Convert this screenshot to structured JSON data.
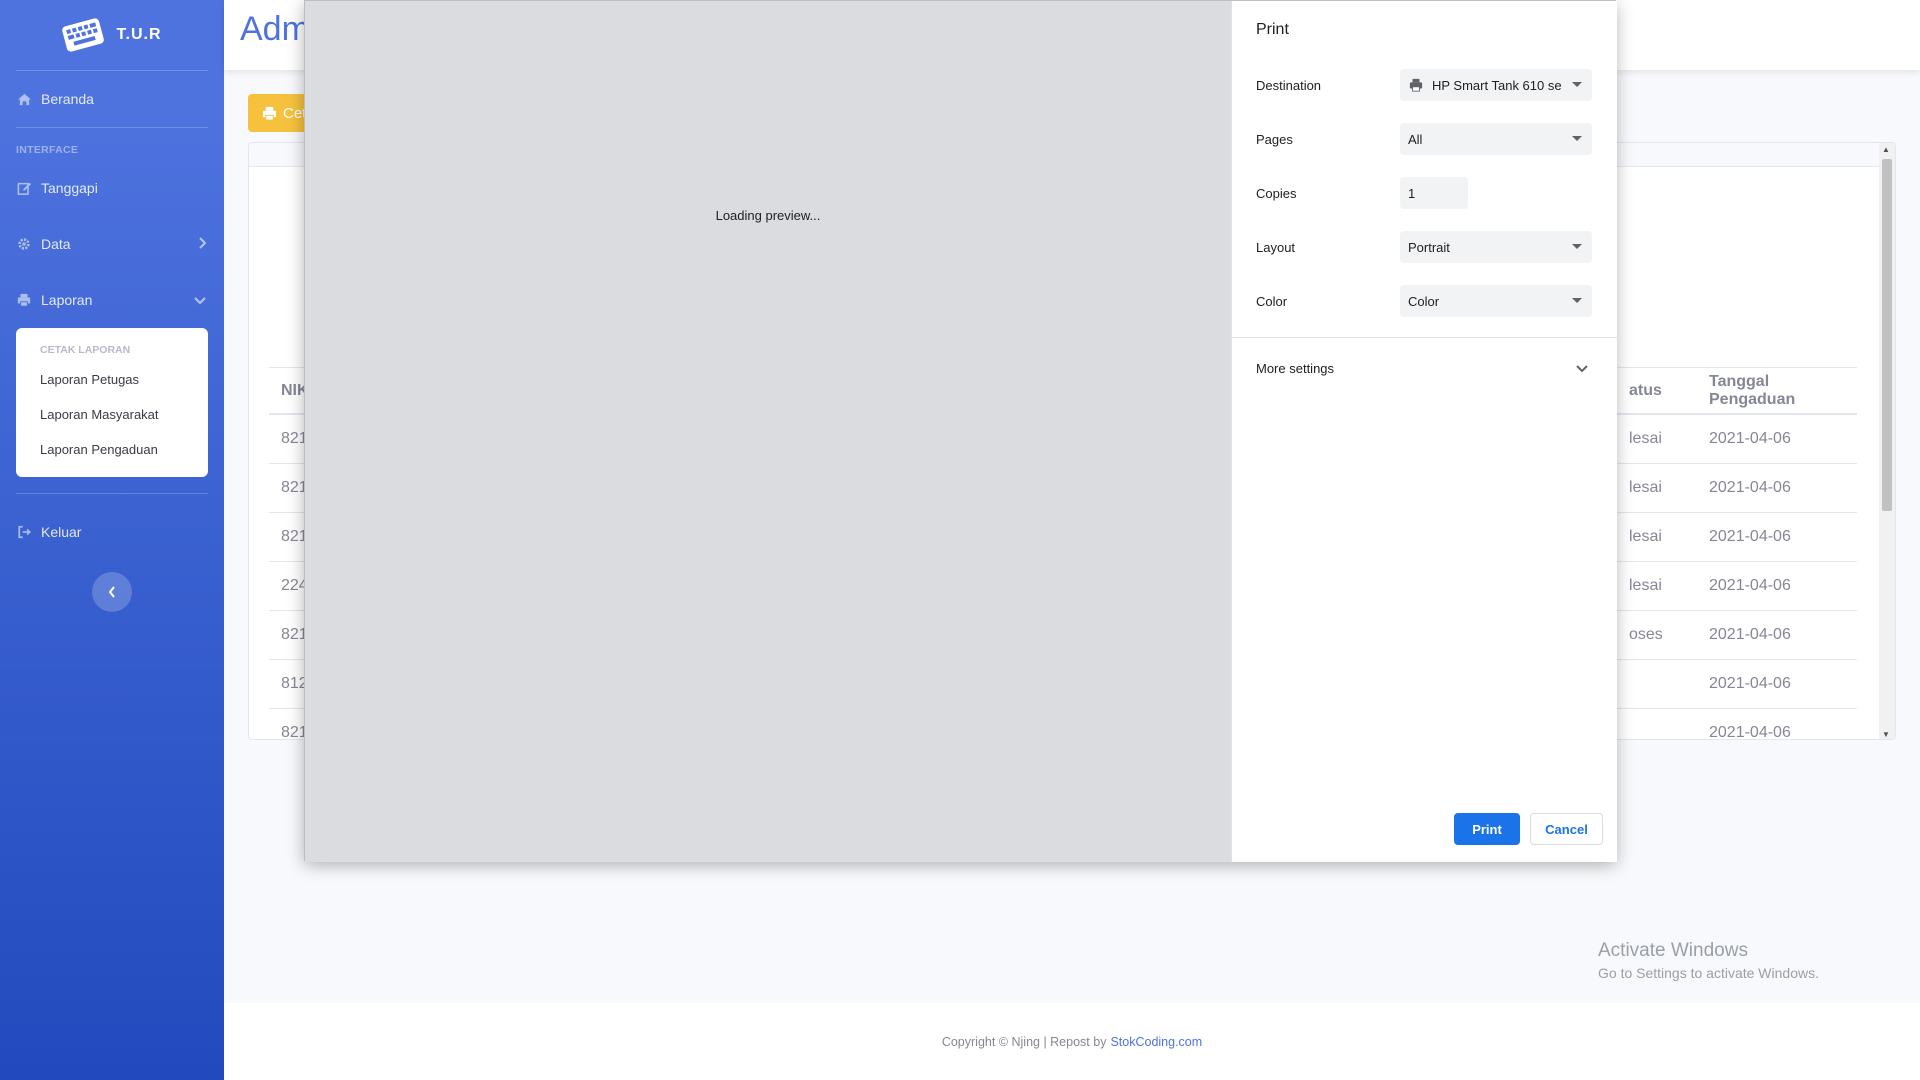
{
  "sidebar": {
    "brand": "T.U.R",
    "home_label": "Beranda",
    "heading_interface": "INTERFACE",
    "items": [
      {
        "label": "Tanggapi"
      },
      {
        "label": "Data"
      },
      {
        "label": "Laporan"
      }
    ],
    "submenu": {
      "header": "CETAK LAPORAN",
      "items": [
        "Laporan Petugas",
        "Laporan Masyarakat",
        "Laporan Pengaduan"
      ]
    },
    "logout_label": "Keluar"
  },
  "topbar": {
    "title": "Adm"
  },
  "content": {
    "print_button": "Cet",
    "table": {
      "headers": [
        "NIK",
        "atus",
        "Tanggal Pengaduan"
      ],
      "rows": [
        [
          "821",
          "lesai",
          "2021-04-06"
        ],
        [
          "821",
          "lesai",
          "2021-04-06"
        ],
        [
          "821",
          "lesai",
          "2021-04-06"
        ],
        [
          "224",
          "lesai",
          "2021-04-06"
        ],
        [
          "821",
          "oses",
          "2021-04-06"
        ],
        [
          "812",
          "",
          "2021-04-06"
        ],
        [
          "821",
          "",
          "2021-04-06"
        ]
      ]
    }
  },
  "print_dialog": {
    "preview_text": "Loading preview...",
    "title": "Print",
    "destination_label": "Destination",
    "destination_value": "HP Smart Tank 610 se",
    "pages_label": "Pages",
    "pages_value": "All",
    "copies_label": "Copies",
    "copies_value": "1",
    "layout_label": "Layout",
    "layout_value": "Portrait",
    "color_label": "Color",
    "color_value": "Color",
    "more_settings": "More settings",
    "print_button": "Print",
    "cancel_button": "Cancel"
  },
  "watermark": {
    "line1": "Activate Windows",
    "line2": "Go to Settings to activate Windows."
  },
  "footer": {
    "text": "Copyright © Njing | Repost by",
    "link": "StokCoding.com"
  },
  "colors": {
    "sidebar": "#4e73df",
    "accent_warning": "#f6c23e",
    "print_blue": "#1a73e8"
  }
}
